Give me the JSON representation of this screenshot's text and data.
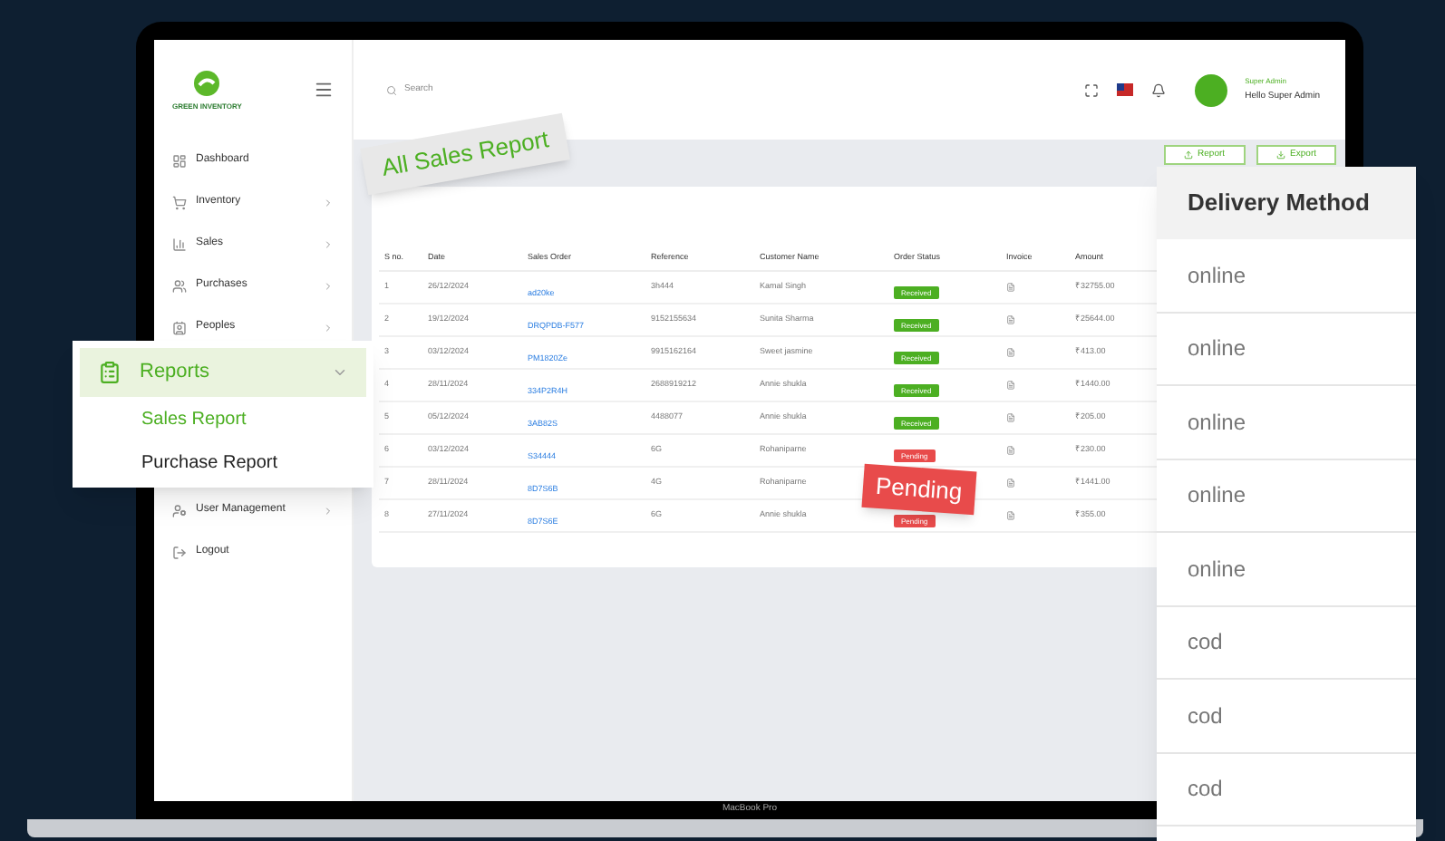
{
  "logo": {
    "text": "GREEN INVENTORY"
  },
  "search": {
    "placeholder": "Search"
  },
  "user": {
    "role": "Super Admin",
    "name": "Hello Super Admin"
  },
  "sidebar": {
    "items": [
      {
        "label": "Dashboard",
        "kind": "dashboard",
        "has_submenu": false
      },
      {
        "label": "Inventory",
        "kind": "inventory",
        "has_submenu": true
      },
      {
        "label": "Sales",
        "kind": "sales",
        "has_submenu": true
      },
      {
        "label": "Purchases",
        "kind": "purchases",
        "has_submenu": true
      },
      {
        "label": "Peoples",
        "kind": "peoples",
        "has_submenu": true
      },
      {
        "label": "User Management",
        "kind": "users",
        "has_submenu": true
      },
      {
        "label": "Logout",
        "kind": "logout",
        "has_submenu": false
      }
    ]
  },
  "actions": [
    {
      "label": "Report",
      "kind": "report"
    },
    {
      "label": "Export",
      "kind": "export"
    }
  ],
  "table": {
    "columns": [
      "S no.",
      "Date",
      "Sales Order",
      "Reference",
      "Customer Name",
      "Order Status",
      "Invoice",
      "Amount"
    ],
    "rows": [
      {
        "sno": "1",
        "date": "26/12/2024",
        "order": "ad20ke",
        "reference": "3h444",
        "customer": "Kamal Singh",
        "status": "Received",
        "color": "#4caf22",
        "amount": "₹32755.00"
      },
      {
        "sno": "2",
        "date": "19/12/2024",
        "order": "DRQPDB-F577",
        "reference": "9152155634",
        "customer": "Sunita Sharma",
        "status": "Received",
        "color": "#4caf22",
        "amount": "₹25644.00"
      },
      {
        "sno": "3",
        "date": "03/12/2024",
        "order": "PM1820Ze",
        "reference": "9915162164",
        "customer": "Sweet jasmine",
        "status": "Received",
        "color": "#4caf22",
        "amount": "₹413.00"
      },
      {
        "sno": "4",
        "date": "28/11/2024",
        "order": "334P2R4H",
        "reference": "2688919212",
        "customer": "Annie shukla",
        "status": "Received",
        "color": "#4caf22",
        "amount": "₹1440.00"
      },
      {
        "sno": "5",
        "date": "05/12/2024",
        "order": "3AB82S",
        "reference": "4488077",
        "customer": "Annie shukla",
        "status": "Received",
        "color": "#4caf22",
        "amount": "₹205.00"
      },
      {
        "sno": "6",
        "date": "03/12/2024",
        "order": "S34444",
        "reference": "6G",
        "customer": "Rohaniparne",
        "status": "Pending",
        "color": "#e84b4b",
        "amount": "₹230.00"
      },
      {
        "sno": "7",
        "date": "28/11/2024",
        "order": "8D7S6B",
        "reference": "4G",
        "customer": "Rohaniparne",
        "amount": "₹1441.00"
      },
      {
        "sno": "8",
        "date": "27/11/2024",
        "order": "8D7S6E",
        "reference": "6G",
        "customer": "Annie shukla",
        "status": "Pending",
        "color": "#e84b4b",
        "amount": "₹355.00"
      }
    ]
  },
  "callouts": {
    "page_title": "All Sales Report",
    "status_tag": "Pending"
  },
  "reports_menu": {
    "label": "Reports",
    "expanded": true,
    "children": [
      {
        "label": "Sales Report",
        "selected": true
      },
      {
        "label": "Purchase Report",
        "selected": false
      }
    ]
  },
  "delivery_panel": {
    "heading": "Delivery Method",
    "values": [
      "online",
      "online",
      "online",
      "online",
      "online",
      "cod",
      "cod",
      "cod"
    ]
  },
  "device_label": "MacBook Pro"
}
